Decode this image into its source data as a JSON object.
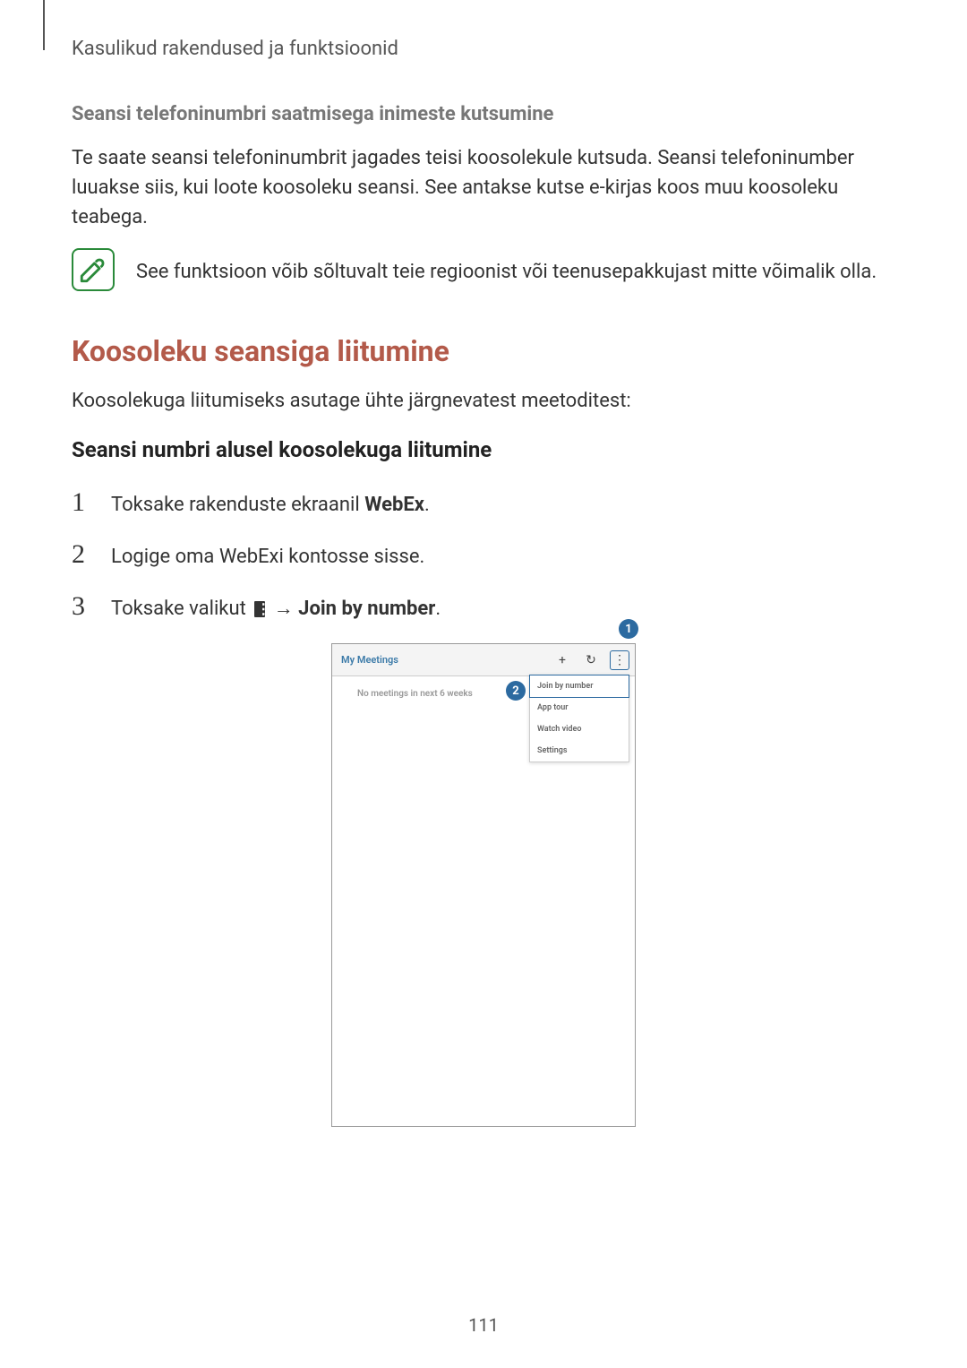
{
  "header": "Kasulikud rakendused ja funktsioonid",
  "section1": {
    "title": "Seansi telefoninumbri saatmisega inimeste kutsumine",
    "body": "Te saate seansi telefoninumbrit jagades teisi koosolekule kutsuda. Seansi telefoninumber luuakse siis, kui loote koosoleku seansi. See antakse kutse e-kirjas koos muu koosoleku teabega.",
    "note": "See funktsioon võib sõltuvalt teie regioonist või teenusepakkujast mitte võimalik olla."
  },
  "section2": {
    "title": "Koosoleku seansiga liitumine",
    "intro": "Koosolekuga liitumiseks asutage ühte järgnevatest meetoditest:",
    "subheading": "Seansi numbri alusel koosolekuga liitumine",
    "steps": {
      "s1_pre": "Toksake rakenduste ekraanil ",
      "s1_bold": "WebEx",
      "s1_post": ".",
      "s2": "Logige oma WebExi kontosse sisse.",
      "s3_pre": "Toksake valikut ",
      "s3_arrow": " → ",
      "s3_bold": "Join by number",
      "s3_post": "."
    }
  },
  "phone": {
    "title": "My Meetings",
    "empty": "No meetings in next 6 weeks",
    "menu": {
      "item1": "Join by number",
      "item2": "App tour",
      "item3": "Watch video",
      "item4": "Settings"
    },
    "callout1": "1",
    "callout2": "2",
    "icons": {
      "plus": "+",
      "refresh": "↻",
      "more": "⋮"
    }
  },
  "page_number": "111"
}
